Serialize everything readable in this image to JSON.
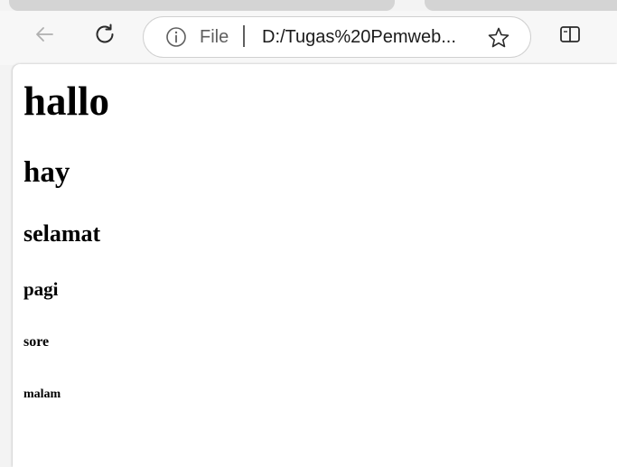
{
  "browser": {
    "toolbar": {
      "back_icon": "arrow-left-icon",
      "reload_icon": "refresh-icon",
      "split_icon": "split-screen-icon"
    },
    "address_bar": {
      "info_icon": "info-icon",
      "scheme_label": "File",
      "url": "D:/Tugas%20Pemweb...",
      "favorite_icon": "star-icon"
    }
  },
  "page": {
    "headings": {
      "h1": "hallo",
      "h2": "hay",
      "h3": "selamat",
      "h4": "pagi",
      "h5": "sore",
      "h6": "malam"
    }
  },
  "colors": {
    "tab_pill_border": "#c0392b",
    "toolbar_bg": "#f7f7f7",
    "page_bg": "#ffffff"
  }
}
